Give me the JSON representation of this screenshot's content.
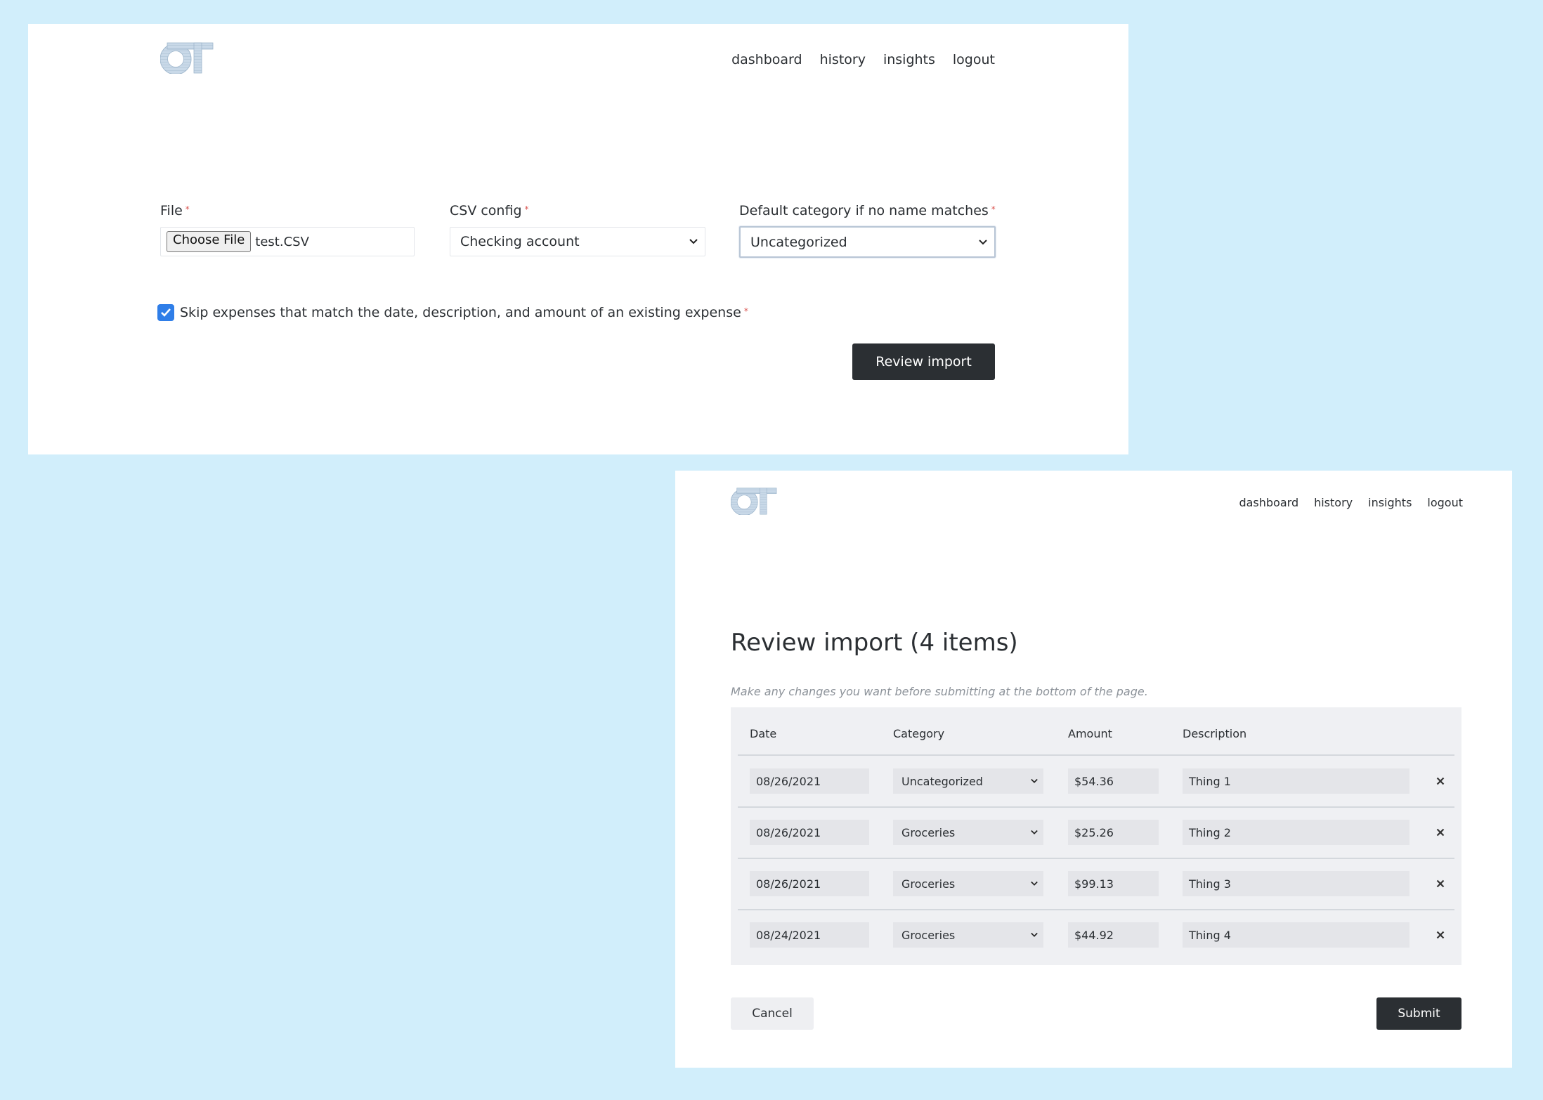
{
  "colors": {
    "background": "#d1eefb",
    "panel": "#ffffff",
    "dark_button": "#2b2f33",
    "checkbox": "#2f7ee8",
    "required_marker": "#d9534f",
    "logo": "#b7cce0"
  },
  "import_form": {
    "logo": "OT",
    "nav": [
      "dashboard",
      "history",
      "insights",
      "logout"
    ],
    "file": {
      "label": "File",
      "required": "*",
      "button_label": "Choose File",
      "file_name": "test.CSV"
    },
    "csv_config": {
      "label": "CSV config",
      "required": "*",
      "selected": "Checking account"
    },
    "default_category": {
      "label": "Default category if no name matches",
      "required": "*",
      "selected": "Uncategorized"
    },
    "skip_duplicates": {
      "label": "Skip expenses that match the date, description, and amount of an existing expense",
      "required": "*",
      "checked": true
    },
    "review_button": "Review import"
  },
  "review": {
    "logo": "OT",
    "nav": [
      "dashboard",
      "history",
      "insights",
      "logout"
    ],
    "title": "Review import (4 items)",
    "subtitle": "Make any changes you want before submitting at the bottom of the page.",
    "columns": [
      "Date",
      "Category",
      "Amount",
      "Description"
    ],
    "rows": [
      {
        "date": "08/26/2021",
        "category": "Uncategorized",
        "amount": "$54.36",
        "description": "Thing 1"
      },
      {
        "date": "08/26/2021",
        "category": "Groceries",
        "amount": "$25.26",
        "description": "Thing 2"
      },
      {
        "date": "08/26/2021",
        "category": "Groceries",
        "amount": "$99.13",
        "description": "Thing 3"
      },
      {
        "date": "08/24/2021",
        "category": "Groceries",
        "amount": "$44.92",
        "description": "Thing 4"
      }
    ],
    "remove_icon": "close-icon",
    "cancel_button": "Cancel",
    "submit_button": "Submit"
  }
}
